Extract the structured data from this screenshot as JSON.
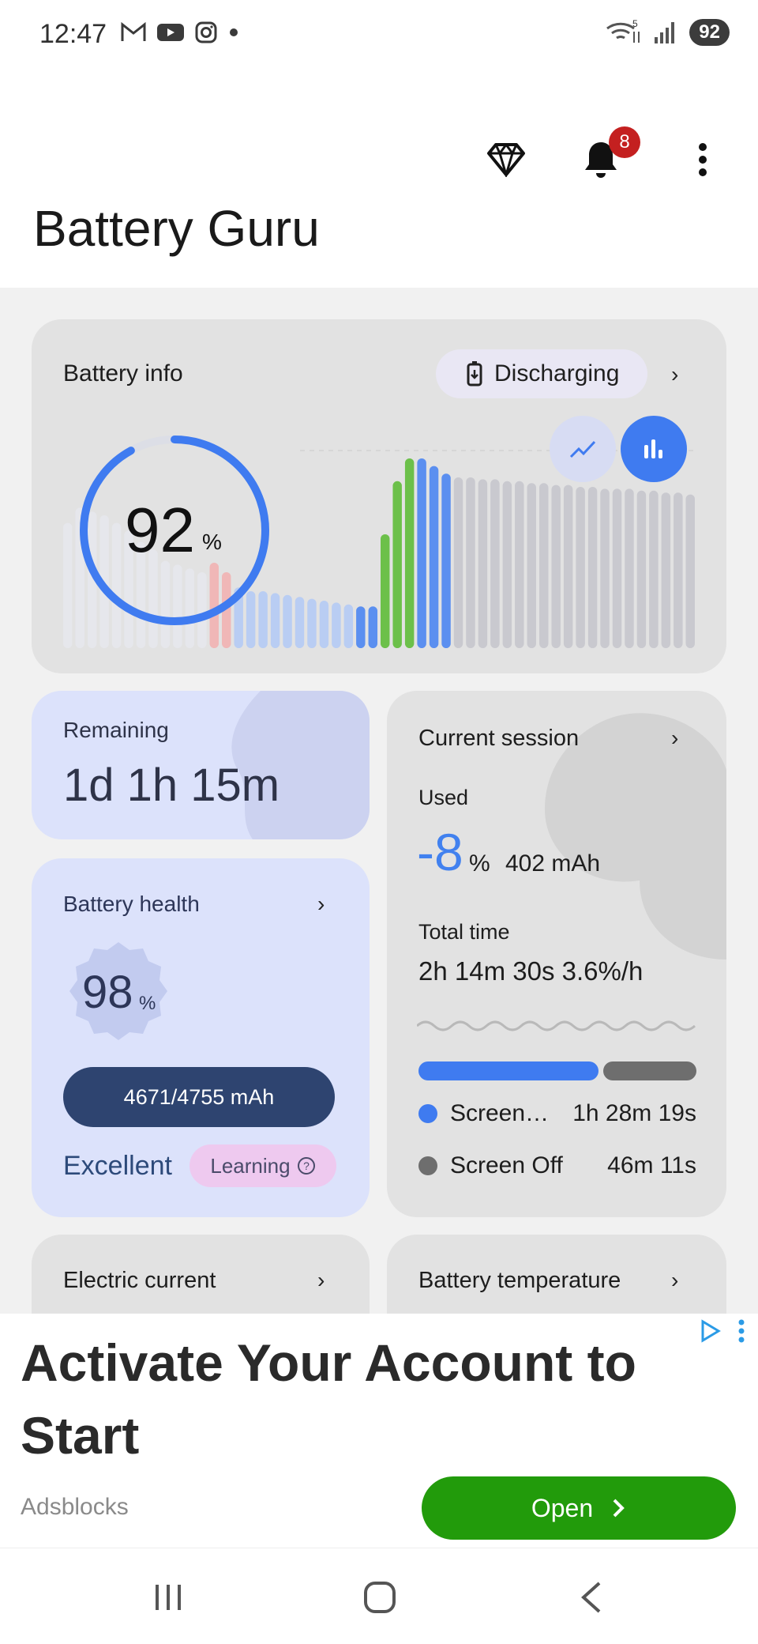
{
  "status_bar": {
    "time": "12:47",
    "battery_level": "92",
    "signal_label": "5"
  },
  "app": {
    "title": "Battery Guru",
    "notification_count": "8"
  },
  "battery_info": {
    "title": "Battery info",
    "status": "Discharging",
    "percent": "92",
    "percent_unit": "%",
    "ring_fraction": 0.92,
    "chart_view": "bar",
    "history": [
      {
        "v": 0.66,
        "c": "faded"
      },
      {
        "v": 0.74,
        "c": "faded"
      },
      {
        "v": 0.72,
        "c": "faded"
      },
      {
        "v": 0.7,
        "c": "faded"
      },
      {
        "v": 0.66,
        "c": "faded"
      },
      {
        "v": 0.62,
        "c": "faded"
      },
      {
        "v": 0.56,
        "c": "faded"
      },
      {
        "v": 0.52,
        "c": "faded"
      },
      {
        "v": 0.46,
        "c": "faded"
      },
      {
        "v": 0.44,
        "c": "faded"
      },
      {
        "v": 0.42,
        "c": "faded"
      },
      {
        "v": 0.4,
        "c": "faded"
      },
      {
        "v": 0.45,
        "c": "red"
      },
      {
        "v": 0.4,
        "c": "red"
      },
      {
        "v": 0.32,
        "c": "lightblue"
      },
      {
        "v": 0.3,
        "c": "lightblue"
      },
      {
        "v": 0.3,
        "c": "lightblue"
      },
      {
        "v": 0.29,
        "c": "lightblue"
      },
      {
        "v": 0.28,
        "c": "lightblue"
      },
      {
        "v": 0.27,
        "c": "lightblue"
      },
      {
        "v": 0.26,
        "c": "lightblue"
      },
      {
        "v": 0.25,
        "c": "lightblue"
      },
      {
        "v": 0.24,
        "c": "lightblue"
      },
      {
        "v": 0.23,
        "c": "lightblue"
      },
      {
        "v": 0.22,
        "c": "blue"
      },
      {
        "v": 0.22,
        "c": "blue"
      },
      {
        "v": 0.6,
        "c": "green"
      },
      {
        "v": 0.88,
        "c": "green"
      },
      {
        "v": 1.0,
        "c": "green"
      },
      {
        "v": 1.0,
        "c": "blue"
      },
      {
        "v": 0.96,
        "c": "blue"
      },
      {
        "v": 0.92,
        "c": "blue"
      },
      {
        "v": 0.9,
        "c": "gray"
      },
      {
        "v": 0.9,
        "c": "gray"
      },
      {
        "v": 0.89,
        "c": "gray"
      },
      {
        "v": 0.89,
        "c": "gray"
      },
      {
        "v": 0.88,
        "c": "gray"
      },
      {
        "v": 0.88,
        "c": "gray"
      },
      {
        "v": 0.87,
        "c": "gray"
      },
      {
        "v": 0.87,
        "c": "gray"
      },
      {
        "v": 0.86,
        "c": "gray"
      },
      {
        "v": 0.86,
        "c": "gray"
      },
      {
        "v": 0.85,
        "c": "gray"
      },
      {
        "v": 0.85,
        "c": "gray"
      },
      {
        "v": 0.84,
        "c": "gray"
      },
      {
        "v": 0.84,
        "c": "gray"
      },
      {
        "v": 0.84,
        "c": "gray"
      },
      {
        "v": 0.83,
        "c": "gray"
      },
      {
        "v": 0.83,
        "c": "gray"
      },
      {
        "v": 0.82,
        "c": "gray"
      },
      {
        "v": 0.82,
        "c": "gray"
      },
      {
        "v": 0.81,
        "c": "gray"
      }
    ]
  },
  "remaining": {
    "label": "Remaining",
    "value": "1d 1h 15m"
  },
  "battery_health": {
    "title": "Battery health",
    "percent": "98",
    "percent_unit": "%",
    "capacity": "4671/4755 mAh",
    "rating": "Excellent",
    "learning_label": "Learning"
  },
  "current_session": {
    "title": "Current session",
    "used_label": "Used",
    "used_value": "-8",
    "used_unit": "%",
    "used_mah": "402 mAh",
    "total_time_label": "Total time",
    "total_time": "2h 14m 30s  3.6%/h",
    "screen_on_label": "Screen…",
    "screen_on_time": "1h 28m 19s",
    "screen_off_label": "Screen Off",
    "screen_off_time": "46m 11s",
    "screen_on_fraction": 0.66
  },
  "next_cards": {
    "electric_current": "Electric current",
    "battery_temperature": "Battery temperature"
  },
  "ad": {
    "headline": "Activate Your Account to Start",
    "source": "Adsblocks",
    "cta": "Open"
  },
  "colors": {
    "accent_blue": "#3f7bf0",
    "green": "#6cc04a",
    "red_faded": "#f0b7b7",
    "health_dark": "#2e4470",
    "ad_green": "#229b0b"
  }
}
